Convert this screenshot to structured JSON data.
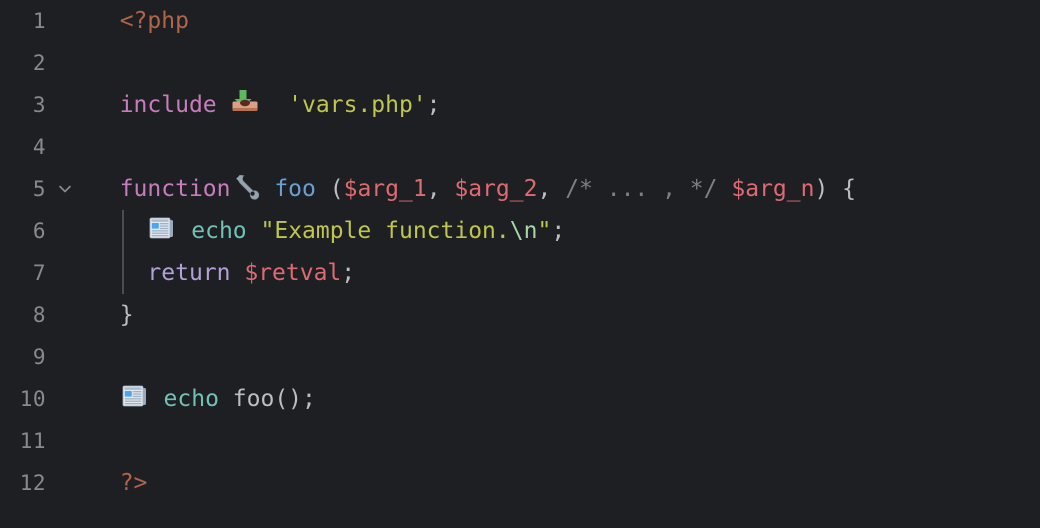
{
  "editor": {
    "language": "php",
    "background_color": "#1e1f22",
    "default_text_color": "#bcbec4",
    "gutter": {
      "line_numbers": [
        "1",
        "2",
        "3",
        "4",
        "5",
        "6",
        "7",
        "8",
        "9",
        "10",
        "11",
        "12"
      ],
      "line_number_color": "#868a91",
      "fold_marker_line": 5,
      "fold_marker_icon": "chevron-down-icon"
    },
    "indent_guide": {
      "color": "#4a4d52",
      "from_line": 6,
      "to_line": 7
    },
    "lines": [
      {
        "number": "1",
        "tokens": [
          {
            "text": "<?php",
            "type": "tag",
            "color": "#b0654a"
          }
        ]
      },
      {
        "number": "2",
        "tokens": []
      },
      {
        "number": "3",
        "tokens": [
          {
            "text": "include ",
            "type": "keyword",
            "color": "#c77dbb"
          },
          {
            "text": "",
            "type": "icon",
            "icon": "inbox-tray-icon"
          },
          {
            "text": "  'vars.php'",
            "type": "string",
            "color": "#bfc54d"
          },
          {
            "text": ";",
            "type": "punct",
            "color": "#bcbec4"
          }
        ]
      },
      {
        "number": "4",
        "tokens": []
      },
      {
        "number": "5",
        "tokens": [
          {
            "text": "function",
            "type": "keyword",
            "color": "#c77dbb"
          },
          {
            "text": "",
            "type": "icon",
            "icon": "wrench-icon"
          },
          {
            "text": " foo ",
            "type": "func",
            "color": "#6a9fd4"
          },
          {
            "text": "(",
            "type": "punct",
            "color": "#bcbec4"
          },
          {
            "text": "$arg_1",
            "type": "var",
            "color": "#de6a72"
          },
          {
            "text": ", ",
            "type": "punct",
            "color": "#bcbec4"
          },
          {
            "text": "$arg_2",
            "type": "var",
            "color": "#de6a72"
          },
          {
            "text": ", ",
            "type": "punct",
            "color": "#bcbec4"
          },
          {
            "text": "/* ... , */",
            "type": "comment",
            "color": "#7c8086"
          },
          {
            "text": " ",
            "type": "punct",
            "color": "#bcbec4"
          },
          {
            "text": "$arg_n",
            "type": "var",
            "color": "#de6a72"
          },
          {
            "text": ") {",
            "type": "punct",
            "color": "#bcbec4"
          }
        ]
      },
      {
        "number": "6",
        "tokens": [
          {
            "text": "  ",
            "type": "punct",
            "color": "#bcbec4"
          },
          {
            "text": "",
            "type": "icon",
            "icon": "newspaper-icon"
          },
          {
            "text": " echo ",
            "type": "echo",
            "color": "#72c0b6"
          },
          {
            "text": "\"Example function.",
            "type": "string",
            "color": "#bfc54d"
          },
          {
            "text": "\\n",
            "type": "escape",
            "color": "#a5d6a7"
          },
          {
            "text": "\"",
            "type": "string",
            "color": "#bfc54d"
          },
          {
            "text": ";",
            "type": "punct",
            "color": "#bcbec4"
          }
        ]
      },
      {
        "number": "7",
        "tokens": [
          {
            "text": "  ",
            "type": "punct",
            "color": "#bcbec4"
          },
          {
            "text": "return ",
            "type": "keyword2",
            "color": "#b4a0d8"
          },
          {
            "text": "$retval",
            "type": "var",
            "color": "#de6a72"
          },
          {
            "text": ";",
            "type": "punct",
            "color": "#bcbec4"
          }
        ]
      },
      {
        "number": "8",
        "tokens": [
          {
            "text": "}",
            "type": "punct",
            "color": "#bcbec4"
          }
        ]
      },
      {
        "number": "9",
        "tokens": []
      },
      {
        "number": "10",
        "tokens": [
          {
            "text": "",
            "type": "icon",
            "icon": "newspaper-icon"
          },
          {
            "text": " echo ",
            "type": "echo",
            "color": "#72c0b6"
          },
          {
            "text": "foo();",
            "type": "plain",
            "color": "#bcbec4"
          }
        ]
      },
      {
        "number": "11",
        "tokens": []
      },
      {
        "number": "12",
        "tokens": [
          {
            "text": "?>",
            "type": "tag",
            "color": "#b0654a"
          }
        ]
      }
    ],
    "source_text": "<?php\n\ninclude 'vars.php';\n\nfunction foo ($arg_1, $arg_2, /* ... , */ $arg_n) {\n  echo \"Example function.\\n\";\n  return $retval;\n}\n\necho foo();\n\n?>"
  }
}
